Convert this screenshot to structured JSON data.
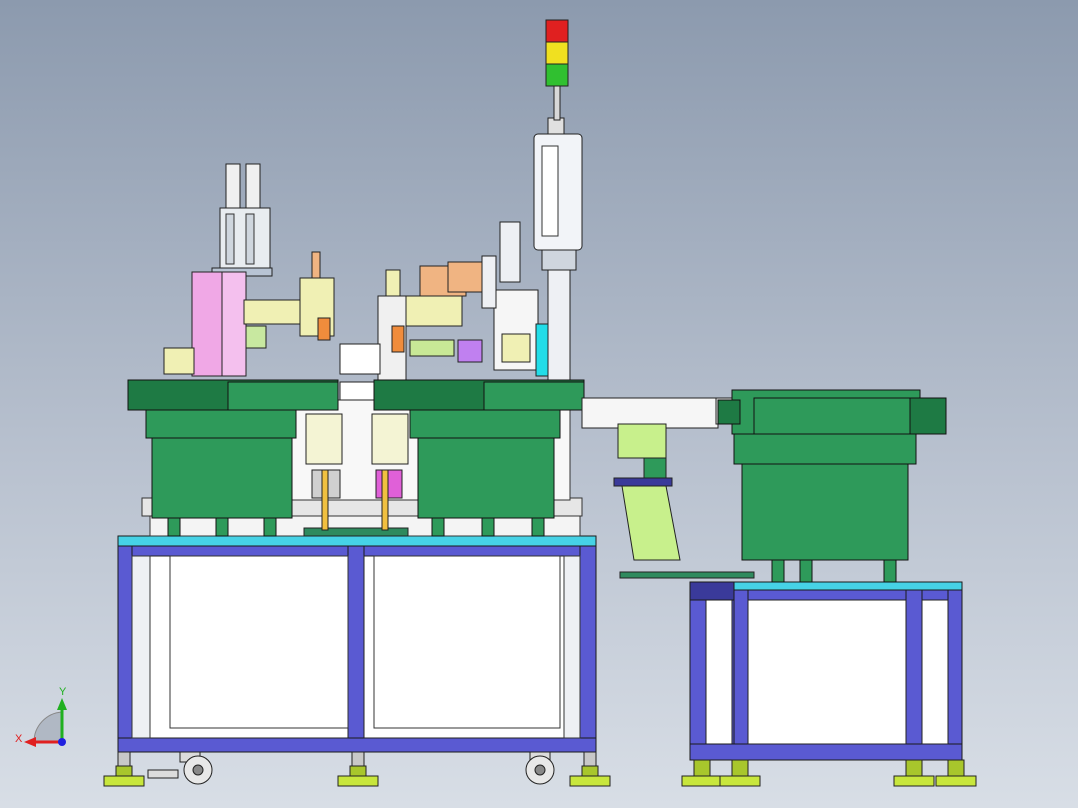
{
  "viewport": {
    "background_top": "#8c9aae",
    "background_bottom": "#d8dee6"
  },
  "colors": {
    "frame_blue": "#5a5ad2",
    "frame_cyan_top": "#46d2e6",
    "bowl_green": "#2e9a5a",
    "bowl_dark_green": "#1e7a44",
    "pink": "#f0a8e6",
    "light_yellow": "#f0f0b4",
    "orange": "#f0b482",
    "cyan": "#22dde8",
    "stacklight_red": "#e02020",
    "stacklight_yellow": "#f0e020",
    "stacklight_green": "#30c030",
    "leveling_foot": "#c8e63c"
  },
  "stack_light": {
    "levels": [
      "red",
      "yellow",
      "green"
    ]
  },
  "triad": {
    "x_label": "X",
    "y_label": "Y",
    "x_color": "#e02020",
    "y_color": "#20b020",
    "z_color": "#2020e0"
  }
}
